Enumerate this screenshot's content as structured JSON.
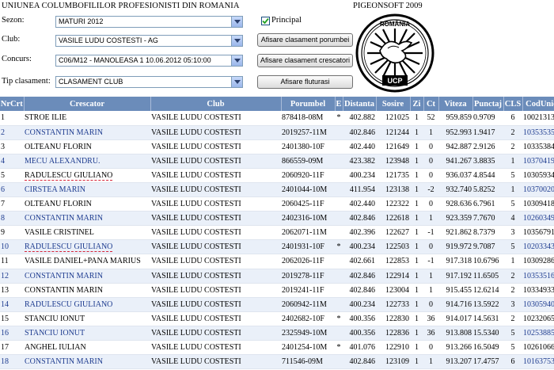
{
  "header": {
    "org_title": "UNIUNEA COLUMBOFILILOR PROFESIONISTI DIN ROMANIA",
    "brand": "PIGEONSOFT 2009",
    "logo_text_top": "ROMÂNIA",
    "logo_text_bottom": "UCP"
  },
  "form": {
    "sezon_label": "Sezon:",
    "sezon_value": "MATURI 2012",
    "club_label": "Club:",
    "club_value": "VASILE LUDU COSTESTI - AG",
    "concurs_label": "Concurs:",
    "concurs_value": "C06/M12 - MANOLEASA 1 10.06.2012 05:10:00",
    "tip_label": "Tip clasament:",
    "tip_value": "CLASAMENT CLUB",
    "principal_label": "Principal",
    "principal_checked": true,
    "btn_porumbei": "Afisare clasament porumbei",
    "btn_crescatori": "Afisare clasament crescatori",
    "btn_fluturasi": "Afisare fluturasi"
  },
  "table": {
    "headers": [
      "NrCrt",
      "Crescator",
      "Club",
      "Porumbel",
      "E",
      "Distanta",
      "Sosire",
      "Zi",
      "Ct",
      "Viteza",
      "Punctaj",
      "CLS",
      "CodUnic"
    ],
    "rows": [
      {
        "nr": "1",
        "crescator": "STROE ILIE",
        "club": "VASILE LUDU COSTESTI",
        "porumbel": "878418-08M",
        "e": "*",
        "distanta": "402.882",
        "sosire": "121025",
        "zi": "1",
        "ct": "52",
        "viteza": "959.859",
        "punctaj": "0.9709",
        "cls": "6",
        "cod": "10021313",
        "blue": false,
        "mark": false
      },
      {
        "nr": "2",
        "crescator": "CONSTANTIN MARIN",
        "club": "VASILE LUDU COSTESTI",
        "porumbel": "2019257-11M",
        "e": "",
        "distanta": "402.846",
        "sosire": "121244",
        "zi": "1",
        "ct": "1",
        "viteza": "952.993",
        "punctaj": "1.9417",
        "cls": "2",
        "cod": "10353535",
        "blue": true,
        "mark": false
      },
      {
        "nr": "3",
        "crescator": "OLTEANU FLORIN",
        "club": "VASILE LUDU COSTESTI",
        "porumbel": "2401380-10F",
        "e": "",
        "distanta": "402.440",
        "sosire": "121649",
        "zi": "1",
        "ct": "0",
        "viteza": "942.887",
        "punctaj": "2.9126",
        "cls": "2",
        "cod": "10335384",
        "blue": false,
        "mark": false
      },
      {
        "nr": "4",
        "crescator": "MECU ALEXANDRU.",
        "club": "VASILE LUDU COSTESTI",
        "porumbel": "866559-09M",
        "e": "",
        "distanta": "423.382",
        "sosire": "123948",
        "zi": "1",
        "ct": "0",
        "viteza": "941.267",
        "punctaj": "3.8835",
        "cls": "1",
        "cod": "10370419",
        "blue": true,
        "mark": false
      },
      {
        "nr": "5",
        "crescator": "RADULESCU GIULIANO",
        "club": "VASILE LUDU COSTESTI",
        "porumbel": "2060920-11F",
        "e": "",
        "distanta": "400.234",
        "sosire": "121735",
        "zi": "1",
        "ct": "0",
        "viteza": "936.037",
        "punctaj": "4.8544",
        "cls": "5",
        "cod": "10305934",
        "blue": false,
        "mark": true
      },
      {
        "nr": "6",
        "crescator": "CIRSTEA MARIN",
        "club": "VASILE LUDU COSTESTI",
        "porumbel": "2401044-10M",
        "e": "",
        "distanta": "411.954",
        "sosire": "123138",
        "zi": "1",
        "ct": "-2",
        "viteza": "932.740",
        "punctaj": "5.8252",
        "cls": "1",
        "cod": "10370020",
        "blue": true,
        "mark": false
      },
      {
        "nr": "7",
        "crescator": "OLTEANU FLORIN",
        "club": "VASILE LUDU COSTESTI",
        "porumbel": "2060425-11F",
        "e": "",
        "distanta": "402.440",
        "sosire": "122322",
        "zi": "1",
        "ct": "0",
        "viteza": "928.636",
        "punctaj": "6.7961",
        "cls": "5",
        "cod": "10309418",
        "blue": false,
        "mark": false
      },
      {
        "nr": "8",
        "crescator": "CONSTANTIN MARIN",
        "club": "VASILE LUDU COSTESTI",
        "porumbel": "2402316-10M",
        "e": "",
        "distanta": "402.846",
        "sosire": "122618",
        "zi": "1",
        "ct": "1",
        "viteza": "923.359",
        "punctaj": "7.7670",
        "cls": "4",
        "cod": "10260349",
        "blue": true,
        "mark": false
      },
      {
        "nr": "9",
        "crescator": "VASILE CRISTINEL",
        "club": "VASILE LUDU COSTESTI",
        "porumbel": "2062071-11M",
        "e": "",
        "distanta": "402.396",
        "sosire": "122627",
        "zi": "1",
        "ct": "-1",
        "viteza": "921.862",
        "punctaj": "8.7379",
        "cls": "3",
        "cod": "10356791",
        "blue": false,
        "mark": false
      },
      {
        "nr": "10",
        "crescator": "RADULESCU GIULIANO",
        "club": "VASILE LUDU COSTESTI",
        "porumbel": "2401931-10F",
        "e": "*",
        "distanta": "400.234",
        "sosire": "122503",
        "zi": "1",
        "ct": "0",
        "viteza": "919.972",
        "punctaj": "9.7087",
        "cls": "5",
        "cod": "10203343",
        "blue": true,
        "mark": true
      },
      {
        "nr": "11",
        "crescator": "VASILE DANIEL+PANA MARIUS",
        "club": "VASILE LUDU COSTESTI",
        "porumbel": "2062026-11F",
        "e": "",
        "distanta": "402.661",
        "sosire": "122853",
        "zi": "1",
        "ct": "-1",
        "viteza": "917.318",
        "punctaj": "10.6796",
        "cls": "1",
        "cod": "10309286",
        "blue": false,
        "mark": false
      },
      {
        "nr": "12",
        "crescator": "CONSTANTIN MARIN",
        "club": "VASILE LUDU COSTESTI",
        "porumbel": "2019278-11F",
        "e": "",
        "distanta": "402.846",
        "sosire": "122914",
        "zi": "1",
        "ct": "1",
        "viteza": "917.192",
        "punctaj": "11.6505",
        "cls": "2",
        "cod": "10353516",
        "blue": true,
        "mark": false
      },
      {
        "nr": "13",
        "crescator": "CONSTANTIN MARIN",
        "club": "VASILE LUDU COSTESTI",
        "porumbel": "2019241-11F",
        "e": "",
        "distanta": "402.846",
        "sosire": "123004",
        "zi": "1",
        "ct": "1",
        "viteza": "915.455",
        "punctaj": "12.6214",
        "cls": "2",
        "cod": "10334933",
        "blue": false,
        "mark": false
      },
      {
        "nr": "14",
        "crescator": "RADULESCU GIULIANO",
        "club": "VASILE LUDU COSTESTI",
        "porumbel": "2060942-11M",
        "e": "",
        "distanta": "400.234",
        "sosire": "122733",
        "zi": "1",
        "ct": "0",
        "viteza": "914.716",
        "punctaj": "13.5922",
        "cls": "3",
        "cod": "10305940",
        "blue": true,
        "mark": false
      },
      {
        "nr": "15",
        "crescator": "STANCIU IONUT",
        "club": "VASILE LUDU COSTESTI",
        "porumbel": "2402682-10F",
        "e": "*",
        "distanta": "400.356",
        "sosire": "122830",
        "zi": "1",
        "ct": "36",
        "viteza": "914.017",
        "punctaj": "14.5631",
        "cls": "2",
        "cod": "10232065",
        "blue": false,
        "mark": false
      },
      {
        "nr": "16",
        "crescator": "STANCIU IONUT",
        "club": "VASILE LUDU COSTESTI",
        "porumbel": "2325949-10M",
        "e": "",
        "distanta": "400.356",
        "sosire": "122836",
        "zi": "1",
        "ct": "36",
        "viteza": "913.808",
        "punctaj": "15.5340",
        "cls": "5",
        "cod": "10253885",
        "blue": true,
        "mark": false
      },
      {
        "nr": "17",
        "crescator": "ANGHEL IULIAN",
        "club": "VASILE LUDU COSTESTI",
        "porumbel": "2401254-10M",
        "e": "*",
        "distanta": "401.076",
        "sosire": "122910",
        "zi": "1",
        "ct": "0",
        "viteza": "913.266",
        "punctaj": "16.5049",
        "cls": "5",
        "cod": "10261066",
        "blue": false,
        "mark": false
      },
      {
        "nr": "18",
        "crescator": "CONSTANTIN MARIN",
        "club": "VASILE LUDU COSTESTI",
        "porumbel": "711546-09M",
        "e": "",
        "distanta": "402.846",
        "sosire": "123109",
        "zi": "1",
        "ct": "1",
        "viteza": "913.207",
        "punctaj": "17.4757",
        "cls": "6",
        "cod": "10163753",
        "blue": true,
        "mark": false
      }
    ]
  }
}
